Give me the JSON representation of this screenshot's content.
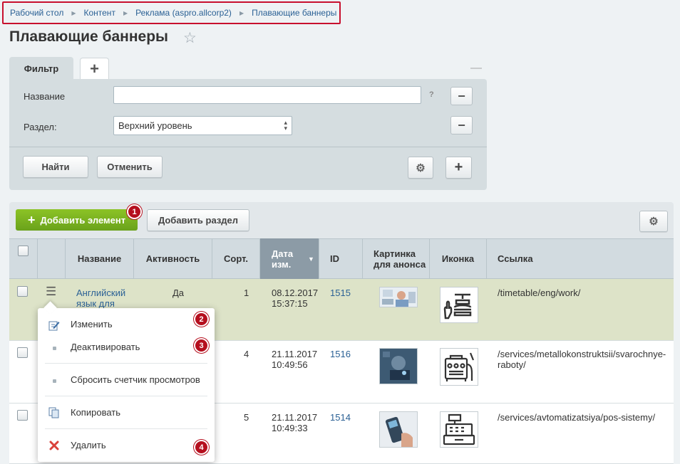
{
  "breadcrumb": [
    "Рабочий стол",
    "Контент",
    "Реклама (aspro.allcorp2)",
    "Плавающие баннеры"
  ],
  "page_title": "Плавающие баннеры",
  "filter": {
    "tab_label": "Фильтр",
    "add_tab": "+",
    "collapse": "—",
    "fields": [
      {
        "label": "Название",
        "value": "",
        "help": "?"
      },
      {
        "label": "Раздел:",
        "value": "Верхний уровень"
      }
    ],
    "find_button": "Найти",
    "cancel_button": "Отменить"
  },
  "toolbar": {
    "add_element": "Добавить элемент",
    "add_section": "Добавить раздел"
  },
  "badges": [
    "1",
    "2",
    "3",
    "4"
  ],
  "table": {
    "headers": [
      "Название",
      "Активность",
      "Сорт.",
      "Дата изм.",
      "ID",
      "Картинка для анонса",
      "Иконка",
      "Ссылка"
    ],
    "rows": [
      {
        "name": "Английский язык для",
        "active": "Да",
        "sort": "1",
        "date": "08.12.2017",
        "time": "15:37:15",
        "id": "1515",
        "link": "/timetable/eng/work/"
      },
      {
        "name": "",
        "active": "",
        "sort": "4",
        "date": "21.11.2017",
        "time": "10:49:56",
        "id": "1516",
        "link": "/services/metallokonstruktsii/svarochnye-raboty/"
      },
      {
        "name": "",
        "active": "",
        "sort": "5",
        "date": "21.11.2017",
        "time": "10:49:33",
        "id": "1514",
        "link": "/services/avtomatizatsiya/pos-sistemy/"
      }
    ]
  },
  "context_menu": [
    "Изменить",
    "Деактивировать",
    "Сбросить счетчик просмотров",
    "Копировать",
    "Удалить"
  ],
  "colors": {
    "accent_green": "#7cb321",
    "badge_red": "#b50f1e",
    "selected_row": "#dde3c8",
    "link": "#2b6195"
  }
}
